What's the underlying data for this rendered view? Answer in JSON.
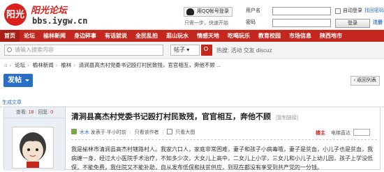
{
  "header": {
    "logo_text": "阳光",
    "site_name": "阳光论坛",
    "site_url": "bbs.iygw.cn",
    "qq_login_label": "用QQ帐号登录",
    "qq_note": "只需一步，快速开始",
    "username_label": "用户名",
    "password_label": "密码",
    "auto_login_label": "自动登录",
    "forgot_password": "找回密码",
    "login_button": "登录",
    "register": "注册"
  },
  "nav": {
    "items": [
      "首页",
      "论坛",
      "榆林新闻",
      "身边碎事",
      "有话就说",
      "全民乱拍",
      "逛山玩水",
      "情感天地",
      "吃喝玩乐",
      "教育校园",
      "市场信息",
      "陕西地市"
    ]
  },
  "search": {
    "placeholder": "请输入搜索内容",
    "type_label": "帖子",
    "hot_label": "热搜:",
    "hot_terms": [
      "活动",
      "交友",
      "discuz"
    ]
  },
  "breadcrumb": [
    "论坛",
    "榆林新闻",
    "榆林",
    "清涧县高杰村党委书记殴打村民致残，官官相互，奔他不顾 ..."
  ],
  "toolbar": {
    "post_label": "发帖",
    "back_label": "返回列表"
  },
  "subheading": "生成文章",
  "thread": {
    "views_label": "查看:",
    "views": "18",
    "replies_label": "回复:",
    "replies": "0",
    "title": "清涧县高杰村党委书记殴打村民致残，官官相互，奔他不顾",
    "copy_link": "[复制链接]",
    "author": "木木",
    "posted_at": "发表于 半小时前",
    "only_author": "只看该作者",
    "big_image": "只看大图",
    "floor_label": "楼主",
    "floor_jump": "电梯直达",
    "content": "我是榆林市清涧县高杰村辖路村人。我家六口人，家庭非常困难，妻子和孩子小病毒哦，妻子是贫血，小儿子也是贫血，我病缠一身，经过大小医院手术治疗，不知多少次，大女儿上高中，二女儿上小学，三女儿和小儿子上幼儿园，孩子上学没低保，不能免费，我住院又不能补助，自从发布低保和扶贫供应，到现在都没有享受到共产党的一分钱。"
  }
}
